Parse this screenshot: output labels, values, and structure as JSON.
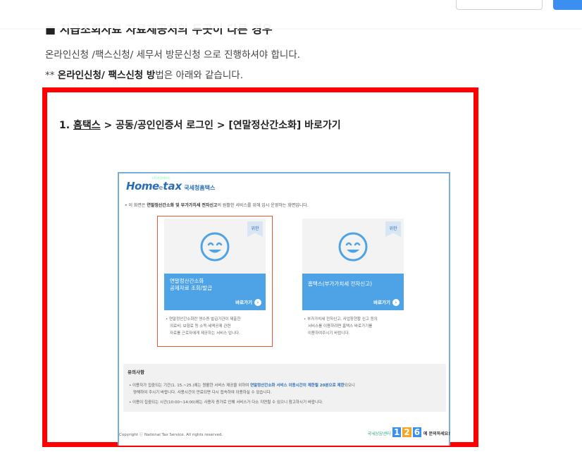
{
  "top": {
    "heading_partial": "■ 지급조회자료 자료제공처의 두곳이 다른 경우"
  },
  "body": {
    "line1": "온라인신청 /팩스신청/ 세무서 방문신청 으로 진행하셔야 합니다.",
    "line2_prefix": "** ",
    "line2_bold": "온라인신청/ 팩스신청 방",
    "line2_rest": "법은 아래와 같습니다."
  },
  "frame": {
    "step_number": "1. ",
    "step_link": "홈택스",
    "step_rest": " > 공동/공인인증서 로그인 > [연말정산간소화] 바로가기",
    "logo": {
      "home": "Home",
      "e": "e",
      "tax": "tax",
      "korean": "국세청홈택스",
      "tagline": "국민과 함께하는"
    },
    "notice_prefix": "• 이 화면은 ",
    "notice_bold": "연말정산간소화 및 부가가치세 전자신고",
    "notice_rest": "의 원활한 서비스를 위해 임시 운영하는 화면입니다.",
    "cards": [
      {
        "badge": "위한",
        "title_line1": "연말정산간소화",
        "title_line2": "공제자료 조회/발급",
        "go": "바로가기",
        "desc": [
          "• 연말정산간소화란 영수증 발급기관이 제출한",
          "의료비, 보험료 등 소득·세액공제 관련",
          "자료를 근로자에게 제공하는 서비스 입니다."
        ]
      },
      {
        "badge": "위한",
        "title_line1": "홈택스(부가가치세 전자신고)",
        "title_line2": "",
        "go": "바로가기",
        "desc": [
          "• 부가가치세 전자신고, 사업장현황 신고 등의",
          "서비스를 이용하려면 홈택스 바로가기를",
          "이용하여주시기 바랍니다."
        ]
      }
    ],
    "caution": {
      "title": "유의사항",
      "line1_pre": "• 이용자가 집중되는 기간(1. 15.~25.)에는 원활한 서비스 제공을 위하여 ",
      "line1_bold": "연말정산간소화 서비스 이용시간이 제한될 20분으로 제한",
      "line1_post": "되오니",
      "line2": "양해하여 주시기 바랍니다. 사용시간이 만료되면 다시 접속하여 이용하실 수 있습니다.",
      "line3": "• 이용이 집중되는 시간(10:00~14:00)에는 사용자 증가로 인해 서비스가 다소 지연될 수 있으니 참고하시기 바랍니다."
    },
    "footer": {
      "copyright": "Copyright ⓒ National Tax Service. All rights reserved.",
      "help_prefix": "국세상담센터",
      "help_num1": "1",
      "help_num2": "2",
      "help_num3": "6",
      "help_suffix": "에 문의하세요!"
    }
  },
  "colors": {
    "frame_border": "#ff0000",
    "card_blue": "#4ea3e6",
    "brand": "#2a6db5",
    "button_primary": "#3a8ff0"
  }
}
